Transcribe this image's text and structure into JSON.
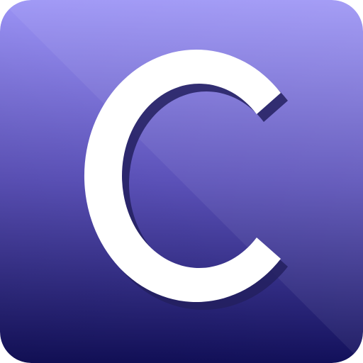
{
  "icon": {
    "name": "letter-c-app-icon",
    "glyph": "C",
    "colors": {
      "gradient_top": "#9B93F5",
      "gradient_mid": "#5B51B8",
      "gradient_bottom": "#12105A",
      "glyph_fill": "#FFFFFF",
      "glyph_shadow": "#23205F"
    }
  }
}
